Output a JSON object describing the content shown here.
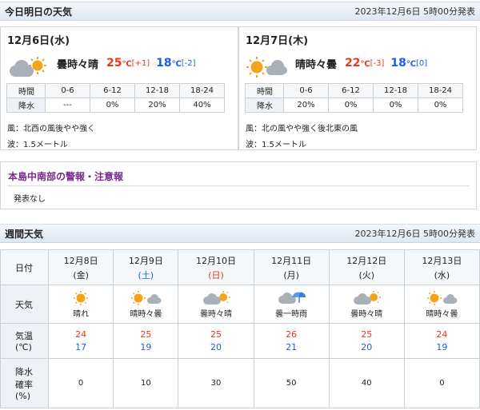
{
  "today_section": {
    "title": "今日明日の天気",
    "issued": "2023年12月6日 5時00分発表"
  },
  "days": [
    {
      "date": "12月6日(水)",
      "weather": "曇時々晴",
      "icon": "cloud-then-sun-icon",
      "high": "25",
      "high_diff": "[+1]",
      "low": "18",
      "low_diff": "[-2]",
      "unit": "℃",
      "pop_header_label": "時間",
      "pop_row_label": "降水",
      "pop_periods": [
        "0-6",
        "6-12",
        "12-18",
        "18-24"
      ],
      "pop_values": [
        "---",
        "0%",
        "20%",
        "40%"
      ],
      "wind": "風：北西の風後やや強く",
      "wave": "波：1.5メートル"
    },
    {
      "date": "12月7日(木)",
      "weather": "晴時々曇",
      "icon": "sun-then-cloud-icon",
      "high": "22",
      "high_diff": "[-3]",
      "low": "18",
      "low_diff": "[0]",
      "unit": "℃",
      "pop_header_label": "時間",
      "pop_row_label": "降水",
      "pop_periods": [
        "0-6",
        "6-12",
        "12-18",
        "18-24"
      ],
      "pop_values": [
        "20%",
        "0%",
        "0%",
        "0%"
      ],
      "wind": "風：北の風やや強く後北東の風",
      "wave": "波：1.5メートル"
    }
  ],
  "warning": {
    "title": "本島中南部の警報・注意報",
    "body": "発表なし"
  },
  "weekly_section": {
    "title": "週間天気",
    "issued": "2023年12月6日 5時00分発表"
  },
  "weekly": {
    "labels": {
      "date": "日付",
      "weather": "天気",
      "temp": "気温\n(℃)",
      "temp_line1": "気温",
      "temp_line2": "(℃)",
      "pop_line1": "降水",
      "pop_line2": "確率",
      "pop_line3": "(%)"
    },
    "days": [
      {
        "date": "12月8日",
        "weekday": "(金)",
        "weekday_type": "weekday",
        "weather": "晴れ",
        "icon": "sun-icon",
        "high": "24",
        "low": "17",
        "pop": "0"
      },
      {
        "date": "12月9日",
        "weekday": "(土)",
        "weekday_type": "saturday",
        "weather": "晴時々曇",
        "icon": "sun-then-cloud-icon",
        "high": "25",
        "low": "19",
        "pop": "10"
      },
      {
        "date": "12月10日",
        "weekday": "(日)",
        "weekday_type": "sunday",
        "weather": "曇時々晴",
        "icon": "cloud-then-sun-icon",
        "high": "25",
        "low": "20",
        "pop": "30"
      },
      {
        "date": "12月11日",
        "weekday": "(月)",
        "weekday_type": "weekday",
        "weather": "曇一時雨",
        "icon": "cloud-rain-icon",
        "high": "26",
        "low": "21",
        "pop": "50"
      },
      {
        "date": "12月12日",
        "weekday": "(火)",
        "weekday_type": "weekday",
        "weather": "曇時々晴",
        "icon": "cloud-then-sun-icon",
        "high": "25",
        "low": "20",
        "pop": "40"
      },
      {
        "date": "12月13日",
        "weekday": "(水)",
        "weekday_type": "weekday",
        "weather": "晴時々曇",
        "icon": "sun-then-cloud-icon",
        "high": "24",
        "low": "19",
        "pop": "0"
      }
    ]
  },
  "colors": {
    "high": "#e8381a",
    "low": "#1a5ee8",
    "warning_title": "#7a2a8c",
    "sun": "#f7a21b",
    "cloud": "#a9b0b8"
  }
}
